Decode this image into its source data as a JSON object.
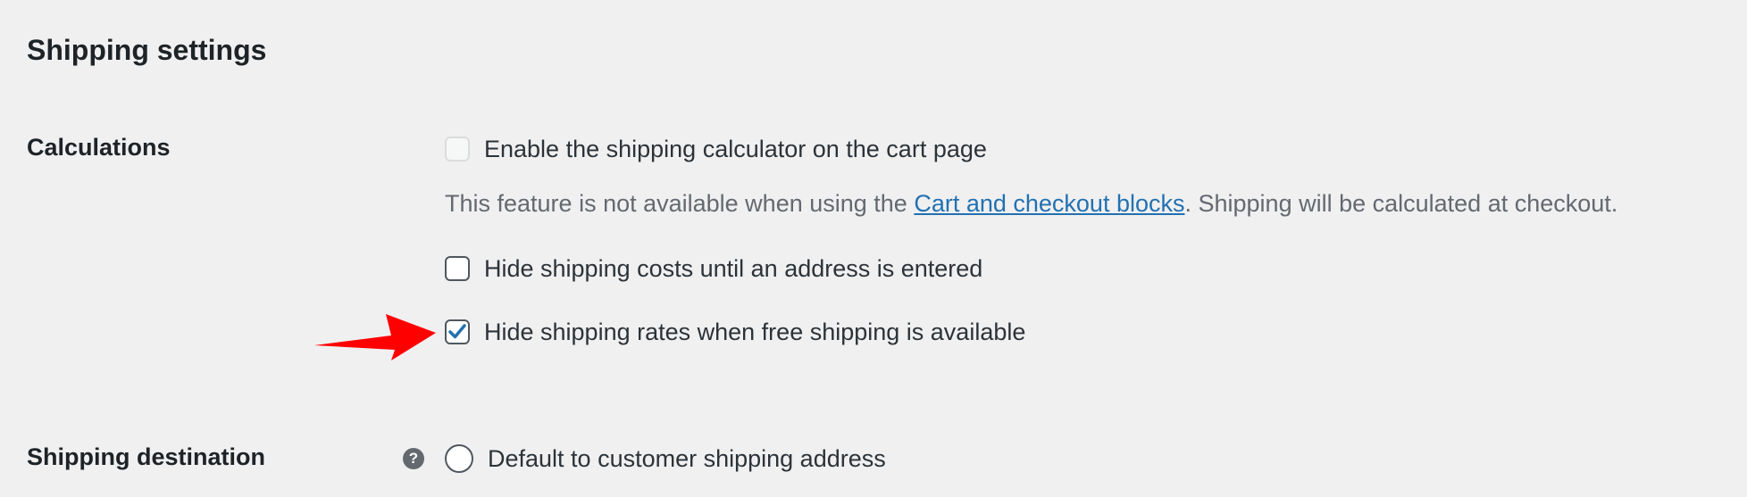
{
  "page": {
    "title": "Shipping settings"
  },
  "calculations": {
    "label": "Calculations",
    "enable_calculator": {
      "label": "Enable the shipping calculator on the cart page",
      "checked": false,
      "disabled": true
    },
    "description": {
      "prefix": "This feature is not available when using the ",
      "link_text": "Cart and checkout blocks",
      "suffix": ". Shipping will be calculated at checkout."
    },
    "hide_costs": {
      "label": "Hide shipping costs until an address is entered",
      "checked": false
    },
    "hide_rates": {
      "label": "Hide shipping rates when free shipping is available",
      "checked": true
    }
  },
  "destination": {
    "label": "Shipping destination",
    "help_icon": "question-mark-icon",
    "help_glyph": "?",
    "default_option": {
      "label": "Default to customer shipping address",
      "selected": false
    }
  },
  "colors": {
    "background": "#f0f0f1",
    "link": "#2271b1",
    "checkmark": "#2271b1",
    "annotation_arrow": "#ff0000"
  }
}
